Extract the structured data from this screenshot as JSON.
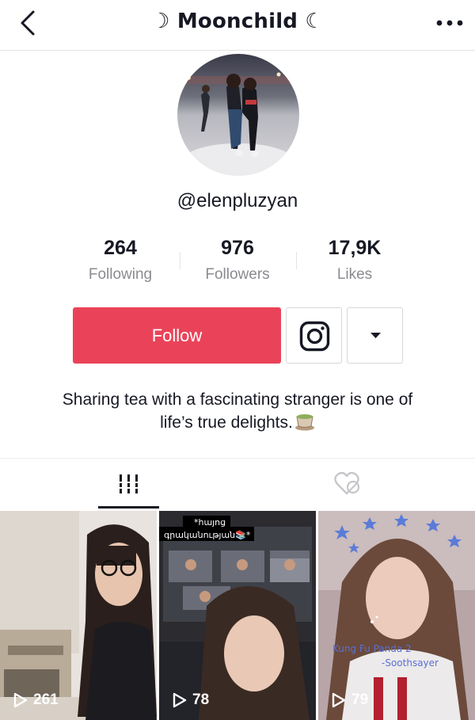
{
  "header": {
    "title": "☽ Moonchild ☾",
    "back_icon": "chevron-left-icon",
    "more_icon": "more-horizontal-icon"
  },
  "profile": {
    "username": "@elenpluzyan",
    "bio_line1": "Sharing tea with a fascinating stranger is one of",
    "bio_line2": "life’s true delights."
  },
  "stats": [
    {
      "value": "264",
      "label": "Following"
    },
    {
      "value": "976",
      "label": "Followers"
    },
    {
      "value": "17,9K",
      "label": "Likes"
    }
  ],
  "actions": {
    "follow_label": "Follow",
    "instagram_icon": "instagram-icon",
    "dropdown_icon": "caret-down-icon"
  },
  "tabs": [
    {
      "name": "videos",
      "icon": "grid-bars-icon",
      "active": true
    },
    {
      "name": "liked",
      "icon": "heart-hidden-icon",
      "active": false
    }
  ],
  "videos": [
    {
      "views": "261"
    },
    {
      "views": "78",
      "caption_line1": "*հայոց",
      "caption_line2": "գրականության📚*"
    },
    {
      "views": "79",
      "caption_line1": "Kung Fu Panda 2",
      "caption_line2": "-Soothsayer"
    }
  ],
  "colors": {
    "accent": "#ea4359",
    "text": "#161823",
    "muted": "#8a8b91",
    "border": "#e3e3e4"
  }
}
